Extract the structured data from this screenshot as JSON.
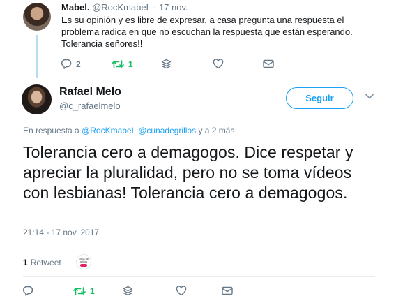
{
  "parent_tweet": {
    "name": "Mabel.",
    "handle": "@RocKmabeL",
    "separator": "·",
    "date": "17 nov.",
    "text": "Es su opinión y es libre de expresar, a casa pregunta una respuesta el problema radica en que no escuchan la respuesta que están esperando. Tolerancia señores!!",
    "reply_count": "2",
    "retweet_count": "1",
    "retweeted": true
  },
  "main_tweet": {
    "name": "Rafael Melo",
    "handle": "@c_rafaelmelo",
    "follow_label": "Seguir",
    "reply_prefix": "En respuesta a",
    "reply_user1": "@RocKmabeL",
    "reply_user2": "@cunadegrillos",
    "reply_suffix": "y a 2 más",
    "text": "Tolerancia cero a demagogos. Dice respetar y apreciar la pluralidad, pero no se toma vídeos con lesbianas! Tolerancia cero a demagogos.",
    "timestamp": "21:14 - 17 nov. 2017",
    "retweet_count": "1",
    "retweet_label": "Retweet",
    "retweeter_avatar_text": "cuna de grillos",
    "action_retweet_count": "1",
    "retweeted": true
  },
  "icons": {
    "reply": "reply-icon",
    "retweet": "retweet-icon",
    "stack": "layers-icon",
    "like": "heart-icon",
    "message": "envelope-icon",
    "chevron": "chevron-down-icon"
  },
  "colors": {
    "accent": "#1da1f2",
    "retweet_green": "#17bf63",
    "muted": "#657786",
    "text": "#14171a",
    "thread_line": "#b6dcf2"
  }
}
